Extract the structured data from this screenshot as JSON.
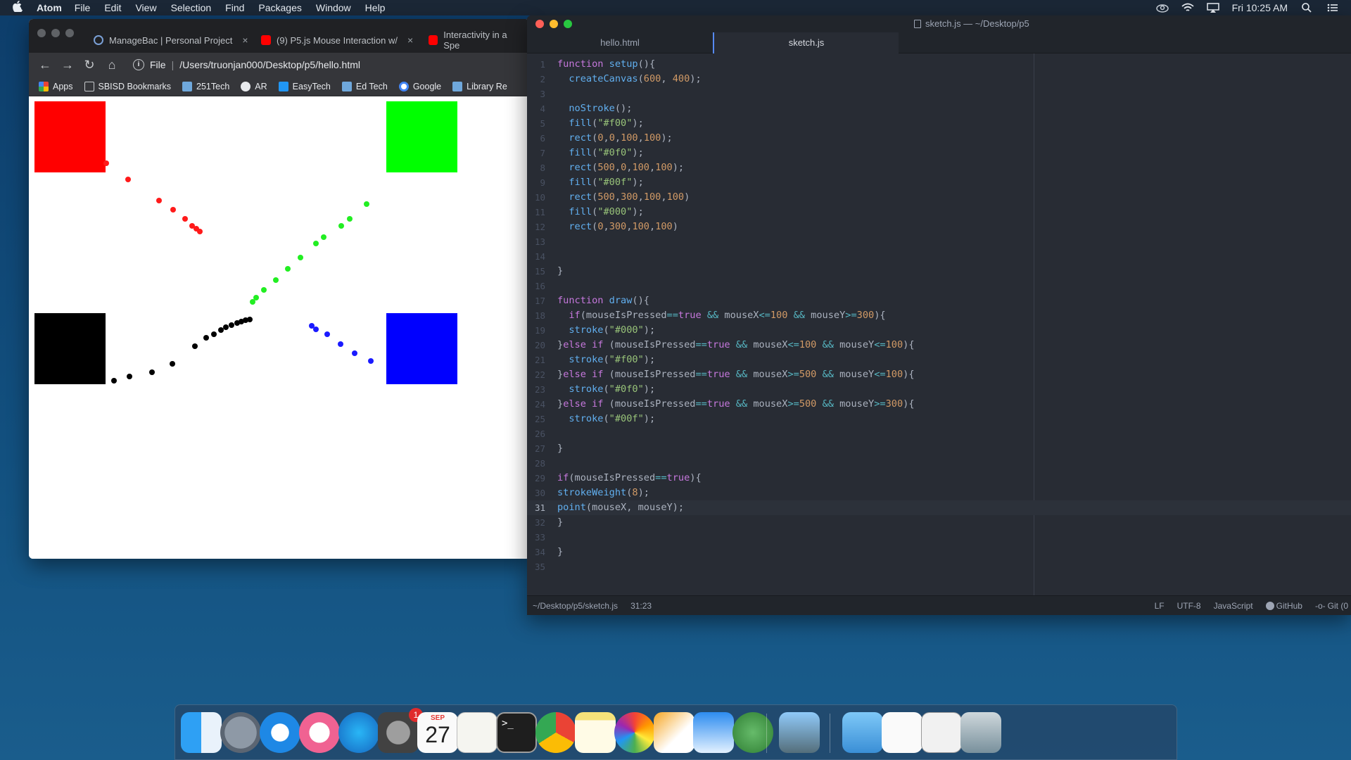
{
  "menubar": {
    "app_name": "Atom",
    "items": [
      "File",
      "Edit",
      "View",
      "Selection",
      "Find",
      "Packages",
      "Window",
      "Help"
    ],
    "clock": "Fri 10:25 AM"
  },
  "chrome": {
    "tabs": [
      {
        "title": "ManageBac | Personal Project",
        "close": "×"
      },
      {
        "title": "(9) P5.js Mouse Interaction w/",
        "close": "×"
      },
      {
        "title": "Interactivity in a Spe",
        "close": ""
      }
    ],
    "toolbar": {
      "back": "←",
      "forward": "→",
      "reload": "↻",
      "home": "⌂",
      "info": "i",
      "url_prefix": "File",
      "url": "/Users/truonjan000/Desktop/p5/hello.html"
    },
    "bookmarks": [
      "Apps",
      "SBISD Bookmarks",
      "251Tech",
      "AR",
      "EasyTech",
      "Ed Tech",
      "Google",
      "Library Re"
    ]
  },
  "atom": {
    "window_title": "sketch.js — ~/Desktop/p5",
    "tabs": [
      {
        "label": "hello.html",
        "active": false
      },
      {
        "label": "sketch.js",
        "active": true
      }
    ],
    "cursor_line": 31,
    "lines": [
      "function setup(){",
      "  createCanvas(600, 400);",
      "",
      "  noStroke();",
      "  fill(\"#f00\");",
      "  rect(0,0,100,100);",
      "  fill(\"#0f0\");",
      "  rect(500,0,100,100);",
      "  fill(\"#00f\");",
      "  rect(500,300,100,100)",
      "  fill(\"#000\");",
      "  rect(0,300,100,100)",
      "",
      "",
      "}",
      "",
      "function draw(){",
      "  if(mouseIsPressed==true && mouseX<=100 && mouseY>=300){",
      "  stroke(\"#000\");",
      "}else if (mouseIsPressed==true && mouseX<=100 && mouseY<=100){",
      "  stroke(\"#f00\");",
      "}else if (mouseIsPressed==true && mouseX>=500 && mouseY<=100){",
      "  stroke(\"#0f0\");",
      "}else if (mouseIsPressed==true && mouseX>=500 && mouseY>=300){",
      "  stroke(\"#00f\");",
      "",
      "}",
      "",
      "if(mouseIsPressed==true){",
      "strokeWeight(8);",
      "point(mouseX, mouseY);",
      "}",
      "",
      "}",
      ""
    ],
    "status": {
      "path": "~/Desktop/p5/sketch.js",
      "position": "31:23",
      "line_ending": "LF",
      "encoding": "UTF-8",
      "grammar": "JavaScript",
      "github": "GitHub",
      "git": "Git (0"
    }
  },
  "canvas": {
    "squares": [
      {
        "color": "#ff0000"
      },
      {
        "color": "#00ff00"
      },
      {
        "color": "#0000ff"
      },
      {
        "color": "#000000"
      }
    ],
    "stroke_colors": {
      "red": "#ff1a1a",
      "green": "#22ee22",
      "blue": "#1a1aff",
      "black": "#000000"
    }
  },
  "dock": {
    "calendar_month": "SEP",
    "calendar_day": "27",
    "badge_count": "1",
    "apps": [
      "Finder",
      "Launchpad",
      "Safari",
      "iTunes",
      "App Store",
      "System Preferences",
      "Calendar",
      "TextEdit",
      "Terminal",
      "Chrome",
      "Notes",
      "Photos",
      "Pages",
      "Keynote",
      "Atom",
      "Preview",
      "Applications",
      "Document",
      "Documents",
      "Trash"
    ]
  }
}
